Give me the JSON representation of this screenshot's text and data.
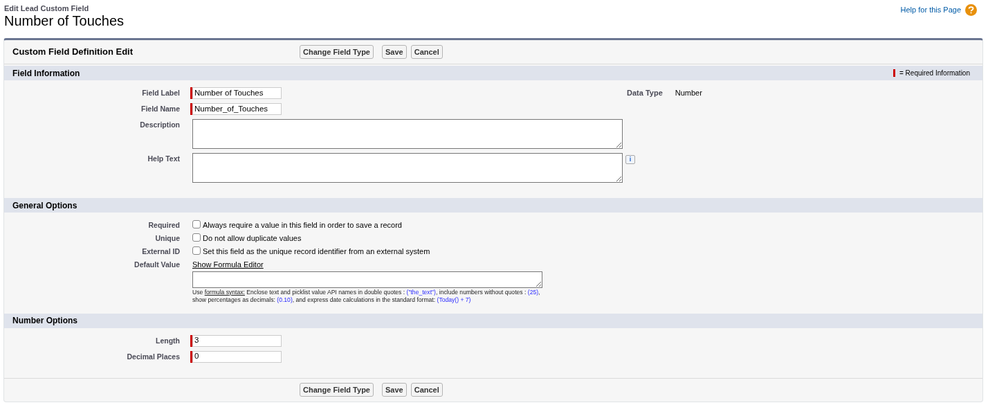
{
  "page": {
    "breadcrumb": "Edit Lead Custom Field",
    "title": "Number of Touches",
    "help_link": "Help for this Page"
  },
  "panel": {
    "title": "Custom Field Definition Edit",
    "buttons": [
      "Change Field Type",
      "Save",
      "Cancel"
    ]
  },
  "sections": [
    {
      "title": "Field Information",
      "legend": "= Required Information",
      "side": {
        "label": "Data Type",
        "value": "Number"
      },
      "fields": [
        {
          "kind": "input",
          "label": "Field Label",
          "value": "Number of Touches",
          "required": true
        },
        {
          "kind": "input",
          "label": "Field Name",
          "value": "Number_of_Touches",
          "required": true
        },
        {
          "kind": "textarea",
          "label": "Description",
          "required": false
        },
        {
          "kind": "textarea",
          "label": "Help Text",
          "required": false,
          "info_button": "i"
        }
      ]
    },
    {
      "title": "General Options",
      "fields": [
        {
          "kind": "checkbox",
          "label": "Required",
          "text": "Always require a value in this field in order to save a record",
          "checked": false
        },
        {
          "kind": "checkbox",
          "label": "Unique",
          "text": "Do not allow duplicate values",
          "checked": false
        },
        {
          "kind": "checkbox",
          "label": "External ID",
          "text": "Set this field as the unique record identifier from an external system",
          "checked": false
        },
        {
          "kind": "formula",
          "label": "Default Value",
          "link": "Show Formula Editor",
          "hint": [
            {
              "kind": "plain",
              "text": "Use "
            },
            {
              "kind": "link",
              "text": "formula syntax:"
            },
            {
              "kind": "plain",
              "text": " Enclose text and picklist value API names in double quotes : "
            },
            {
              "kind": "example",
              "text": "(\"the_text\")"
            },
            {
              "kind": "plain",
              "text": ", include numbers without quotes : "
            },
            {
              "kind": "example",
              "text": "(25)"
            },
            {
              "kind": "plain",
              "text": ", show percentages as decimals: "
            },
            {
              "kind": "example",
              "text": "(0.10)"
            },
            {
              "kind": "plain",
              "text": ", and express date calculations in the standard format: "
            },
            {
              "kind": "example",
              "text": "(Today() + 7)"
            }
          ]
        }
      ]
    },
    {
      "title": "Number Options",
      "fields": [
        {
          "kind": "input",
          "label": "Length",
          "value": "3",
          "required": true
        },
        {
          "kind": "input",
          "label": "Decimal Places",
          "value": "0",
          "required": true
        }
      ]
    }
  ],
  "footer": {
    "buttons": [
      "Change Field Type",
      "Save",
      "Cancel"
    ]
  }
}
